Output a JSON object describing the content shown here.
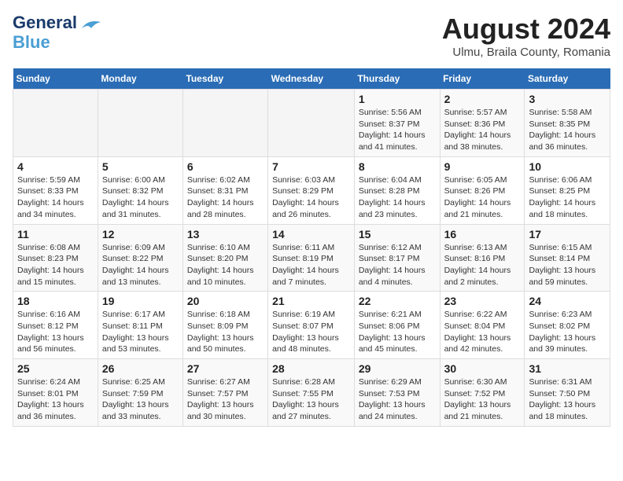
{
  "logo": {
    "line1": "General",
    "line2": "Blue"
  },
  "title": "August 2024",
  "subtitle": "Ulmu, Braila County, Romania",
  "days_of_week": [
    "Sunday",
    "Monday",
    "Tuesday",
    "Wednesday",
    "Thursday",
    "Friday",
    "Saturday"
  ],
  "weeks": [
    [
      {
        "day": "",
        "info": ""
      },
      {
        "day": "",
        "info": ""
      },
      {
        "day": "",
        "info": ""
      },
      {
        "day": "",
        "info": ""
      },
      {
        "day": "1",
        "info": "Sunrise: 5:56 AM\nSunset: 8:37 PM\nDaylight: 14 hours and 41 minutes."
      },
      {
        "day": "2",
        "info": "Sunrise: 5:57 AM\nSunset: 8:36 PM\nDaylight: 14 hours and 38 minutes."
      },
      {
        "day": "3",
        "info": "Sunrise: 5:58 AM\nSunset: 8:35 PM\nDaylight: 14 hours and 36 minutes."
      }
    ],
    [
      {
        "day": "4",
        "info": "Sunrise: 5:59 AM\nSunset: 8:33 PM\nDaylight: 14 hours and 34 minutes."
      },
      {
        "day": "5",
        "info": "Sunrise: 6:00 AM\nSunset: 8:32 PM\nDaylight: 14 hours and 31 minutes."
      },
      {
        "day": "6",
        "info": "Sunrise: 6:02 AM\nSunset: 8:31 PM\nDaylight: 14 hours and 28 minutes."
      },
      {
        "day": "7",
        "info": "Sunrise: 6:03 AM\nSunset: 8:29 PM\nDaylight: 14 hours and 26 minutes."
      },
      {
        "day": "8",
        "info": "Sunrise: 6:04 AM\nSunset: 8:28 PM\nDaylight: 14 hours and 23 minutes."
      },
      {
        "day": "9",
        "info": "Sunrise: 6:05 AM\nSunset: 8:26 PM\nDaylight: 14 hours and 21 minutes."
      },
      {
        "day": "10",
        "info": "Sunrise: 6:06 AM\nSunset: 8:25 PM\nDaylight: 14 hours and 18 minutes."
      }
    ],
    [
      {
        "day": "11",
        "info": "Sunrise: 6:08 AM\nSunset: 8:23 PM\nDaylight: 14 hours and 15 minutes."
      },
      {
        "day": "12",
        "info": "Sunrise: 6:09 AM\nSunset: 8:22 PM\nDaylight: 14 hours and 13 minutes."
      },
      {
        "day": "13",
        "info": "Sunrise: 6:10 AM\nSunset: 8:20 PM\nDaylight: 14 hours and 10 minutes."
      },
      {
        "day": "14",
        "info": "Sunrise: 6:11 AM\nSunset: 8:19 PM\nDaylight: 14 hours and 7 minutes."
      },
      {
        "day": "15",
        "info": "Sunrise: 6:12 AM\nSunset: 8:17 PM\nDaylight: 14 hours and 4 minutes."
      },
      {
        "day": "16",
        "info": "Sunrise: 6:13 AM\nSunset: 8:16 PM\nDaylight: 14 hours and 2 minutes."
      },
      {
        "day": "17",
        "info": "Sunrise: 6:15 AM\nSunset: 8:14 PM\nDaylight: 13 hours and 59 minutes."
      }
    ],
    [
      {
        "day": "18",
        "info": "Sunrise: 6:16 AM\nSunset: 8:12 PM\nDaylight: 13 hours and 56 minutes."
      },
      {
        "day": "19",
        "info": "Sunrise: 6:17 AM\nSunset: 8:11 PM\nDaylight: 13 hours and 53 minutes."
      },
      {
        "day": "20",
        "info": "Sunrise: 6:18 AM\nSunset: 8:09 PM\nDaylight: 13 hours and 50 minutes."
      },
      {
        "day": "21",
        "info": "Sunrise: 6:19 AM\nSunset: 8:07 PM\nDaylight: 13 hours and 48 minutes."
      },
      {
        "day": "22",
        "info": "Sunrise: 6:21 AM\nSunset: 8:06 PM\nDaylight: 13 hours and 45 minutes."
      },
      {
        "day": "23",
        "info": "Sunrise: 6:22 AM\nSunset: 8:04 PM\nDaylight: 13 hours and 42 minutes."
      },
      {
        "day": "24",
        "info": "Sunrise: 6:23 AM\nSunset: 8:02 PM\nDaylight: 13 hours and 39 minutes."
      }
    ],
    [
      {
        "day": "25",
        "info": "Sunrise: 6:24 AM\nSunset: 8:01 PM\nDaylight: 13 hours and 36 minutes."
      },
      {
        "day": "26",
        "info": "Sunrise: 6:25 AM\nSunset: 7:59 PM\nDaylight: 13 hours and 33 minutes."
      },
      {
        "day": "27",
        "info": "Sunrise: 6:27 AM\nSunset: 7:57 PM\nDaylight: 13 hours and 30 minutes."
      },
      {
        "day": "28",
        "info": "Sunrise: 6:28 AM\nSunset: 7:55 PM\nDaylight: 13 hours and 27 minutes."
      },
      {
        "day": "29",
        "info": "Sunrise: 6:29 AM\nSunset: 7:53 PM\nDaylight: 13 hours and 24 minutes."
      },
      {
        "day": "30",
        "info": "Sunrise: 6:30 AM\nSunset: 7:52 PM\nDaylight: 13 hours and 21 minutes."
      },
      {
        "day": "31",
        "info": "Sunrise: 6:31 AM\nSunset: 7:50 PM\nDaylight: 13 hours and 18 minutes."
      }
    ]
  ]
}
